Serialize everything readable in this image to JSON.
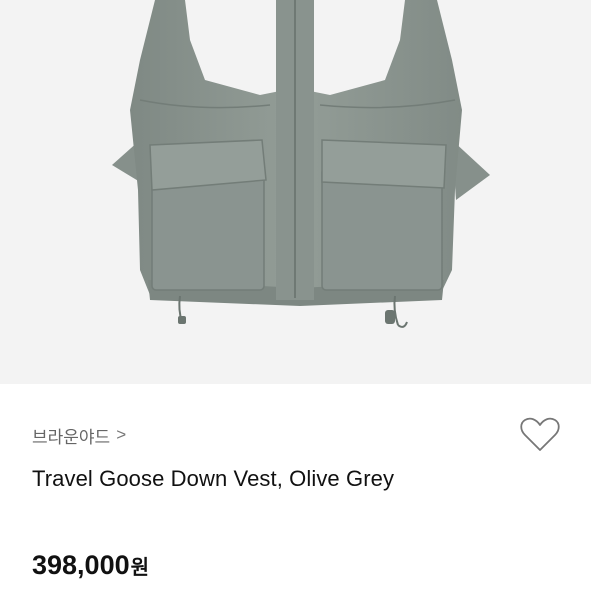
{
  "product": {
    "image_alt": "vest-product-photo",
    "brand": "브라운야드",
    "brand_chevron": ">",
    "title": "Travel Goose Down Vest, Olive Grey",
    "price": "398,000",
    "currency": "원",
    "wishlist_icon": "heart-outline-icon"
  },
  "colors": {
    "image_background": "#f3f3f3",
    "vest": "#8e9892",
    "text_primary": "#111111",
    "text_secondary": "#666666"
  }
}
